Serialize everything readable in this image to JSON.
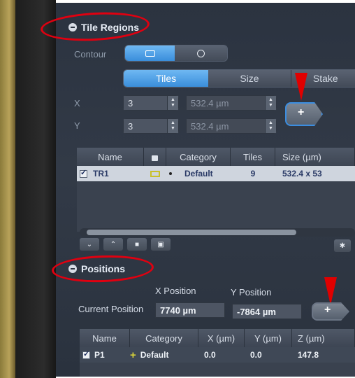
{
  "tile_regions": {
    "title": "Tile Regions",
    "contour_label": "Contour",
    "tabs": [
      "Tiles",
      "Size",
      "Stake"
    ],
    "x_label": "X",
    "y_label": "Y",
    "x_tiles": "3",
    "y_tiles": "3",
    "x_size": "532.4 µm",
    "y_size": "532.4 µm",
    "add_label": "+",
    "table": {
      "columns": [
        "Name",
        "",
        "Category",
        "Tiles",
        "Size (µm)"
      ],
      "rows": [
        {
          "checked": true,
          "name": "TR1",
          "category": "Default",
          "tiles": "9",
          "size": "532.4 x 53"
        }
      ]
    }
  },
  "positions": {
    "title": "Positions",
    "x_header": "X Position",
    "y_header": "Y Position",
    "current_label": "Current Position",
    "current_x": "7740 µm",
    "current_y": "-7864 µm",
    "add_label": "+",
    "table": {
      "columns": [
        "Name",
        "Category",
        "X (µm)",
        "Y (µm)",
        "Z (µm)"
      ],
      "rows": [
        {
          "checked": true,
          "name": "P1",
          "marker": "+",
          "category": "Default",
          "x": "0.0",
          "y": "0.0",
          "z": "147.8"
        }
      ]
    }
  },
  "colors": {
    "accent_blue": "#3a8edb",
    "annotation_red": "#e00010"
  },
  "icons": {
    "contour_rect": "rectangle-icon",
    "contour_circle": "circle-icon",
    "lock": "lock-icon",
    "gear": "gear-icon"
  }
}
